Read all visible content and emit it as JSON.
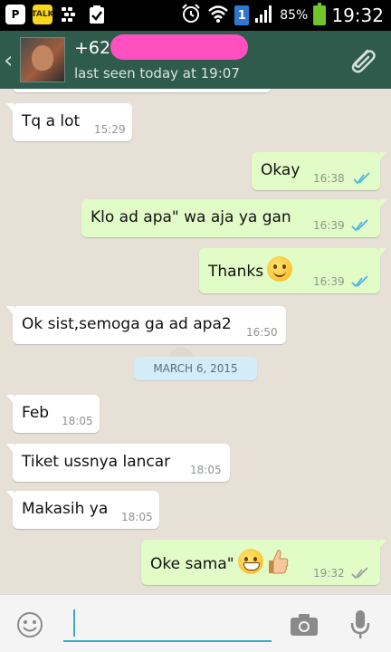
{
  "status_bar": {
    "left_icons": [
      "pinterest-icon",
      "kakaotalk-icon",
      "blackberry-messenger-icon",
      "clipboard-check-icon"
    ],
    "sim_slot": "1",
    "battery_percent": "85%",
    "time": "19:32"
  },
  "header": {
    "contact_name": "+62",
    "last_seen": "last seen today at 19:07"
  },
  "messages": [
    {
      "direction": "in",
      "text": "Tq a lot",
      "time": "15:29"
    },
    {
      "direction": "out",
      "text": "Okay",
      "time": "16:38",
      "status": "read"
    },
    {
      "direction": "out",
      "text": "Klo ad apa\" wa aja ya gan",
      "time": "16:39",
      "status": "read"
    },
    {
      "direction": "out",
      "text": "Thanks",
      "emoji": "smile",
      "time": "16:39",
      "status": "read"
    },
    {
      "direction": "in",
      "text": "Ok sist,semoga ga ad apa2",
      "time": "16:50"
    },
    {
      "direction": "in",
      "text": "Feb",
      "time": "18:05"
    },
    {
      "direction": "in",
      "text": "Tiket ussnya lancar",
      "time": "18:05"
    },
    {
      "direction": "in",
      "text": "Makasih ya",
      "time": "18:05"
    },
    {
      "direction": "out",
      "text": "Oke sama\"",
      "emoji": "grin-thumbsup",
      "time": "19:32",
      "status": "delivered"
    }
  ],
  "date_separator": "MARCH 6, 2015",
  "colors": {
    "header_bg": "#2f5b4d",
    "outgoing_bubble": "#e1fcc6",
    "incoming_bubble": "#ffffff",
    "read_ticks": "#4fb3e0",
    "delivered_ticks": "#9aa39c",
    "input_accent": "#38a9c9"
  },
  "input": {
    "value": "",
    "placeholder": ""
  }
}
